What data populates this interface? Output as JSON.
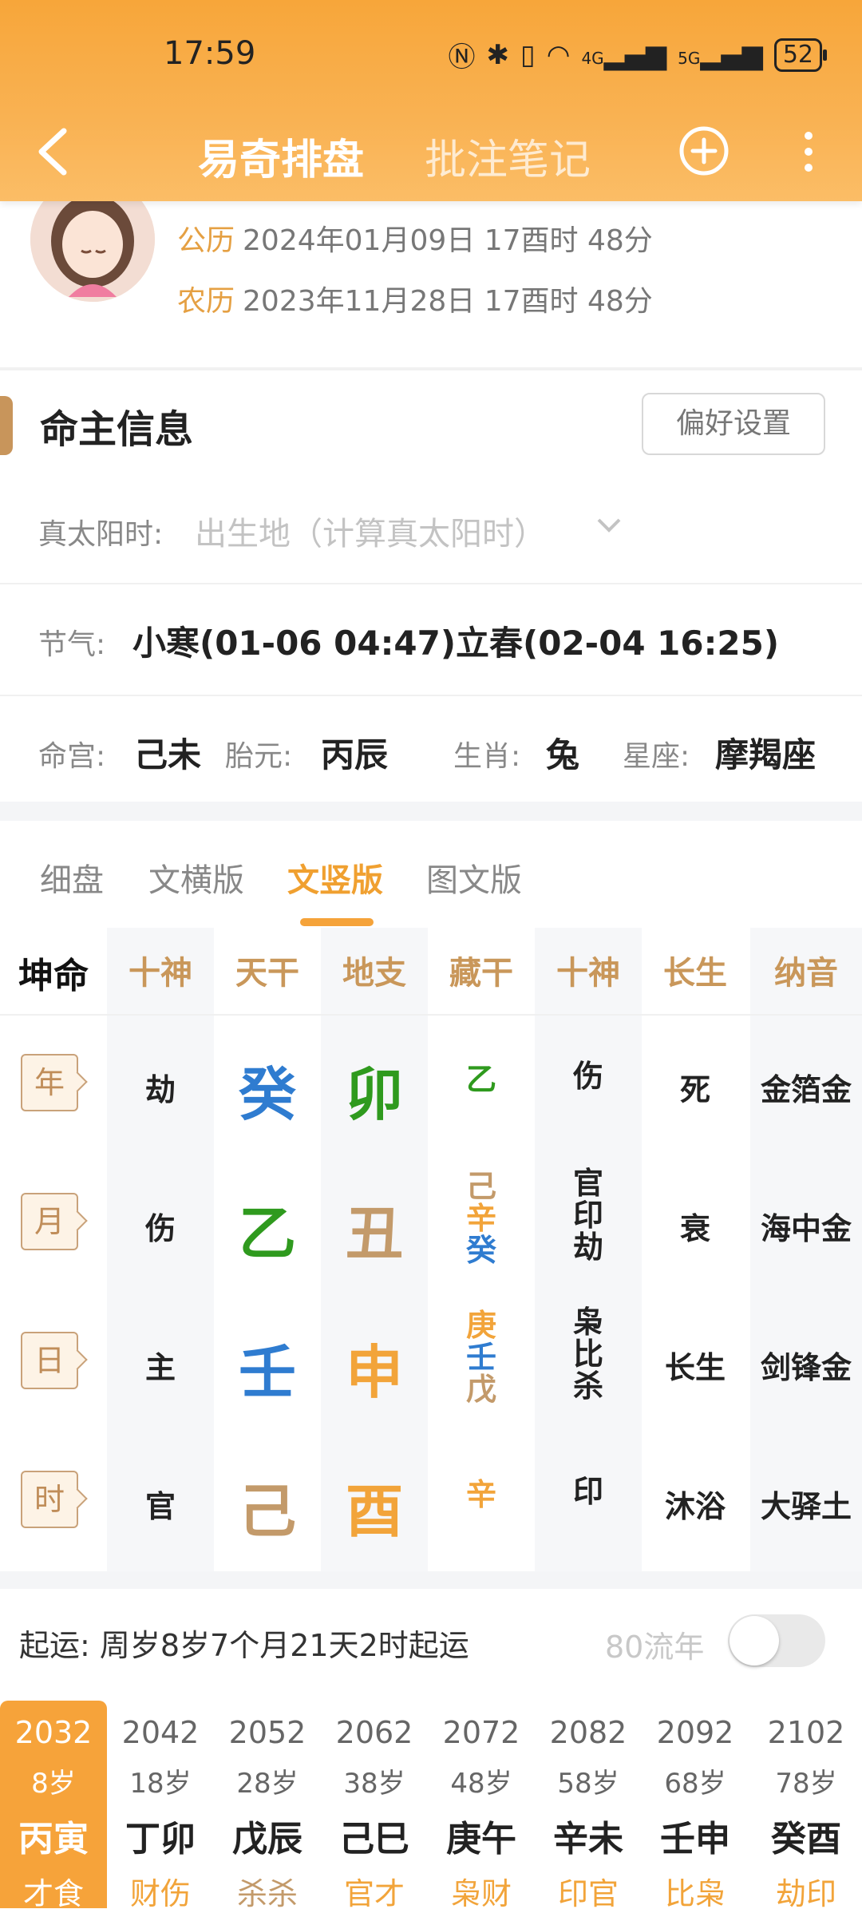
{
  "status": {
    "time": "17:59",
    "battery": "52",
    "net1": "4G",
    "net2": "5G"
  },
  "nav": {
    "tab_active": "易奇排盘",
    "tab_inactive": "批注笔记"
  },
  "profile": {
    "solar_label": "公历",
    "solar_value": "2024年01月09日 17酉时 48分",
    "lunar_label": "农历",
    "lunar_value": "2023年11月28日 17酉时 48分"
  },
  "owner": {
    "title": "命主信息",
    "pref_button": "偏好设置",
    "solar_time_label": "真太阳时:",
    "solar_time_placeholder": "出生地（计算真太阳时）",
    "jieqi_label": "节气:",
    "jieqi_value": "小寒(01-06 04:47)立春(02-04 16:25)",
    "minggong_label": "命宫:",
    "minggong_value": "己未",
    "taiyuan_label": "胎元:",
    "taiyuan_value": "丙辰",
    "shengxiao_label": "生肖:",
    "shengxiao_value": "兔",
    "xingzuo_label": "星座:",
    "xingzuo_value": "摩羯座"
  },
  "view_tabs": [
    "细盘",
    "文横版",
    "文竖版",
    "图文版"
  ],
  "chart": {
    "headers": [
      "坤命",
      "十神",
      "天干",
      "地支",
      "藏干",
      "十神",
      "长生",
      "纳音"
    ],
    "rows": [
      {
        "pillar": "年",
        "shishen": "劫",
        "tiangan": "癸",
        "dizhi": "卯",
        "canggan": [
          "乙"
        ],
        "cg_shishen": [
          "伤"
        ],
        "changsheng": "死",
        "nayin": "金箔金"
      },
      {
        "pillar": "月",
        "shishen": "伤",
        "tiangan": "乙",
        "dizhi": "丑",
        "canggan": [
          "己",
          "辛",
          "癸"
        ],
        "cg_shishen": [
          "官",
          "印",
          "劫"
        ],
        "changsheng": "衰",
        "nayin": "海中金"
      },
      {
        "pillar": "日",
        "shishen": "主",
        "tiangan": "壬",
        "dizhi": "申",
        "canggan": [
          "庚",
          "壬",
          "戊"
        ],
        "cg_shishen": [
          "枭",
          "比",
          "杀"
        ],
        "changsheng": "长生",
        "nayin": "剑锋金"
      },
      {
        "pillar": "时",
        "shishen": "官",
        "tiangan": "己",
        "dizhi": "酉",
        "canggan": [
          "辛"
        ],
        "cg_shishen": [
          "印"
        ],
        "changsheng": "沐浴",
        "nayin": "大驿土"
      }
    ]
  },
  "luck": {
    "qiyun": "起运:  周岁8岁7个月21天2时起运",
    "liunian_label": "80流年",
    "dayun": [
      {
        "year": "2032",
        "age": "8岁",
        "ganzhi": "丙寅",
        "shen": "才食"
      },
      {
        "year": "2042",
        "age": "18岁",
        "ganzhi": "丁卯",
        "shen": "财伤"
      },
      {
        "year": "2052",
        "age": "28岁",
        "ganzhi": "戊辰",
        "shen": "杀杀"
      },
      {
        "year": "2062",
        "age": "38岁",
        "ganzhi": "己巳",
        "shen": "官才"
      },
      {
        "year": "2072",
        "age": "48岁",
        "ganzhi": "庚午",
        "shen": "枭财"
      },
      {
        "year": "2082",
        "age": "58岁",
        "ganzhi": "辛未",
        "shen": "印官"
      },
      {
        "year": "2092",
        "age": "68岁",
        "ganzhi": "壬申",
        "shen": "比枭"
      },
      {
        "year": "2102",
        "age": "78岁",
        "ganzhi": "癸酉",
        "shen": "劫印"
      }
    ]
  },
  "colors": {
    "accent": "#f6a33a",
    "wood": "#2f9a1e",
    "water": "#2f7cd0",
    "earth": "#c39a6a",
    "metal": "#f2a43a"
  }
}
